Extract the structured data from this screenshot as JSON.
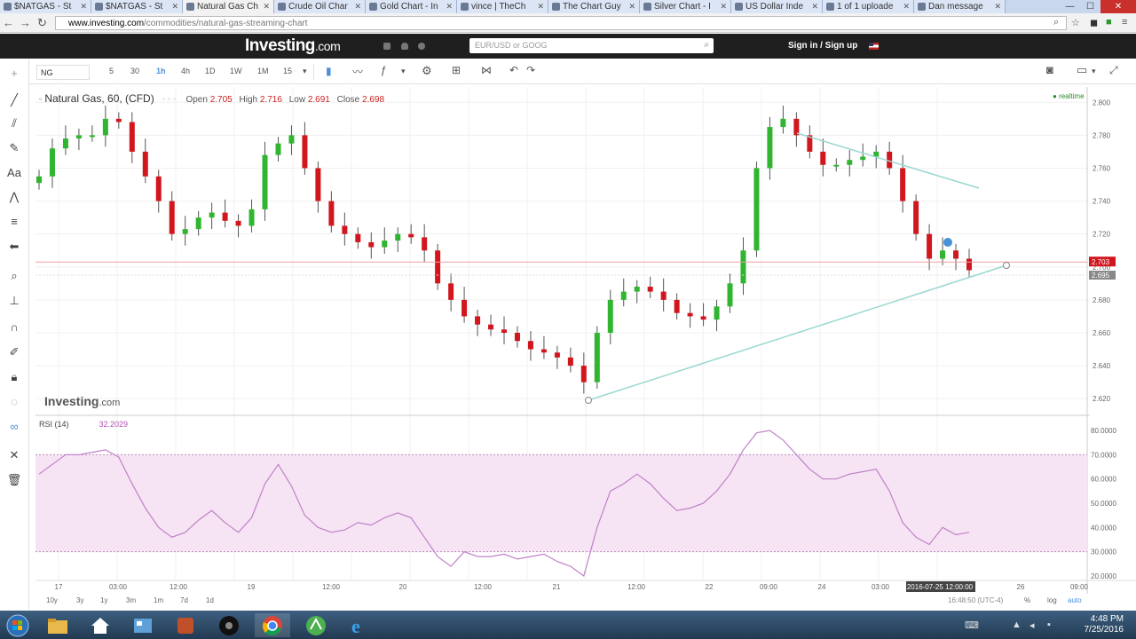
{
  "browser": {
    "tabs": [
      {
        "label": "$NATGAS - St",
        "active": false
      },
      {
        "label": "$NATGAS - St",
        "active": false
      },
      {
        "label": "Natural Gas Ch",
        "active": true
      },
      {
        "label": "Crude Oil Char",
        "active": false
      },
      {
        "label": "Gold Chart - In",
        "active": false
      },
      {
        "label": "vince | TheCh",
        "active": false
      },
      {
        "label": "The Chart Guy",
        "active": false
      },
      {
        "label": "Silver Chart - I",
        "active": false
      },
      {
        "label": "US Dollar Inde",
        "active": false
      },
      {
        "label": "1 of 1 uploade",
        "active": false
      },
      {
        "label": "Dan message",
        "active": false
      }
    ],
    "url_host": "www.investing.com",
    "url_path": "/commodities/natural-gas-streaming-chart"
  },
  "site": {
    "logo": "Investing",
    "logo_domain": ".com",
    "search_placeholder": "EUR/USD or GOOG",
    "signin": "Sign in / Sign up"
  },
  "toolbar": {
    "symbol": "NG",
    "intervals": [
      "5",
      "30",
      "1h",
      "4h",
      "1D",
      "1W",
      "1M",
      "15"
    ],
    "active_interval": "1h"
  },
  "chart": {
    "title": "Natural Gas, 60, (CFD)",
    "open_label": "Open",
    "open": "2.705",
    "high_label": "High",
    "high": "2.716",
    "low_label": "Low",
    "low": "2.691",
    "close_label": "Close",
    "close": "2.698",
    "realtime": "realtime",
    "watermark": "Investing",
    "watermark_domain": ".com",
    "rsi_label": "RSI (14)",
    "rsi_value": "32.2029",
    "price_tag": "2.703",
    "price_tag2": "2.695",
    "cursor_date": "2016-07-25 12:00:00",
    "time_status": "16:48:50 (UTC-4)",
    "colors": {
      "up": "#2fb52f",
      "down": "#d2161e",
      "rsi": "#c080c8",
      "trend": "#9ad8d0"
    }
  },
  "chart_data": {
    "type": "candlestick",
    "title": "Natural Gas, 60, (CFD)",
    "y_ticks": [
      "2.800",
      "2.780",
      "2.760",
      "2.740",
      "2.720",
      "2.700",
      "2.680",
      "2.660",
      "2.640",
      "2.620"
    ],
    "ylim": [
      2.612,
      2.805
    ],
    "x_ticks": [
      "17",
      "03:00",
      "12:00",
      "19",
      "12:00",
      "20",
      "12:00",
      "21",
      "12:00",
      "22",
      "09:00",
      "24",
      "03:00",
      "2016-07-25 12:00:00",
      "26",
      "09:00"
    ],
    "close_series": [
      2.755,
      2.772,
      2.778,
      2.78,
      2.78,
      2.79,
      2.788,
      2.77,
      2.755,
      2.74,
      2.72,
      2.723,
      2.73,
      2.733,
      2.728,
      2.725,
      2.735,
      2.768,
      2.775,
      2.78,
      2.76,
      2.74,
      2.725,
      2.72,
      2.715,
      2.712,
      2.716,
      2.72,
      2.718,
      2.71,
      2.69,
      2.68,
      2.67,
      2.665,
      2.662,
      2.66,
      2.655,
      2.65,
      2.648,
      2.645,
      2.64,
      2.63,
      2.66,
      2.68,
      2.685,
      2.688,
      2.685,
      2.68,
      2.672,
      2.67,
      2.668,
      2.676,
      2.69,
      2.71,
      2.76,
      2.785,
      2.79,
      2.78,
      2.77,
      2.762,
      2.762,
      2.765,
      2.767,
      2.77,
      2.76,
      2.74,
      2.72,
      2.705,
      2.71,
      2.705,
      2.698
    ],
    "rsi": {
      "ylim": [
        20,
        80
      ],
      "y_ticks": [
        "80.0000",
        "70.0000",
        "60.0000",
        "50.0000",
        "40.0000",
        "30.0000",
        "20.0000"
      ],
      "values": [
        62,
        66,
        70,
        70,
        71,
        72,
        69,
        58,
        48,
        40,
        36,
        38,
        43,
        47,
        42,
        38,
        44,
        58,
        66,
        57,
        45,
        40,
        38,
        39,
        42,
        41,
        44,
        46,
        44,
        36,
        28,
        24,
        30,
        28,
        28,
        29,
        27,
        28,
        29,
        26,
        24,
        20,
        40,
        55,
        58,
        62,
        58,
        52,
        47,
        48,
        50,
        55,
        62,
        72,
        79,
        80,
        76,
        70,
        64,
        60,
        60,
        62,
        63,
        64,
        55,
        42,
        36,
        33,
        40,
        37,
        38
      ]
    }
  },
  "rangebar": {
    "items": [
      "10y",
      "3y",
      "1y",
      "3m",
      "1m",
      "7d",
      "1d"
    ],
    "log": "log",
    "auto": "auto",
    "pct": "%"
  },
  "taskbar": {
    "time": "4:48 PM",
    "date": "7/25/2016"
  }
}
